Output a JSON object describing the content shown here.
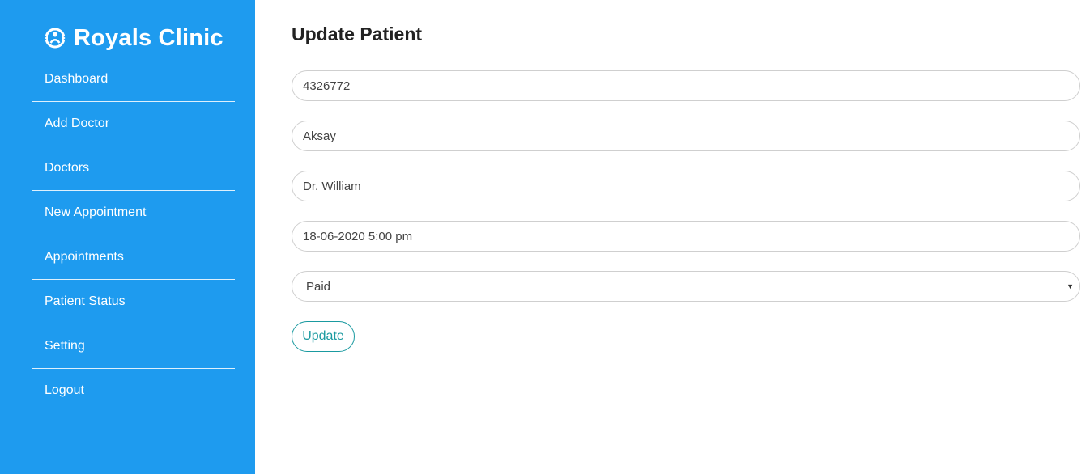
{
  "brand": {
    "title": "Royals Clinic",
    "icon": "clinic-logo-icon"
  },
  "sidebar": {
    "items": [
      {
        "label": "Dashboard"
      },
      {
        "label": "Add Doctor"
      },
      {
        "label": "Doctors"
      },
      {
        "label": "New Appointment"
      },
      {
        "label": "Appointments"
      },
      {
        "label": "Patient Status"
      },
      {
        "label": "Setting"
      },
      {
        "label": "Logout"
      }
    ]
  },
  "main": {
    "title": "Update Patient",
    "form": {
      "patient_id": "4326772",
      "patient_name": "Aksay",
      "doctor": "Dr. William",
      "datetime": "18-06-2020 5:00 pm",
      "payment_status": "Paid",
      "submit_label": "Update"
    }
  },
  "colors": {
    "sidebar_bg": "#1e9bef",
    "accent": "#1a9aa0",
    "input_border": "#cfcfcf"
  }
}
